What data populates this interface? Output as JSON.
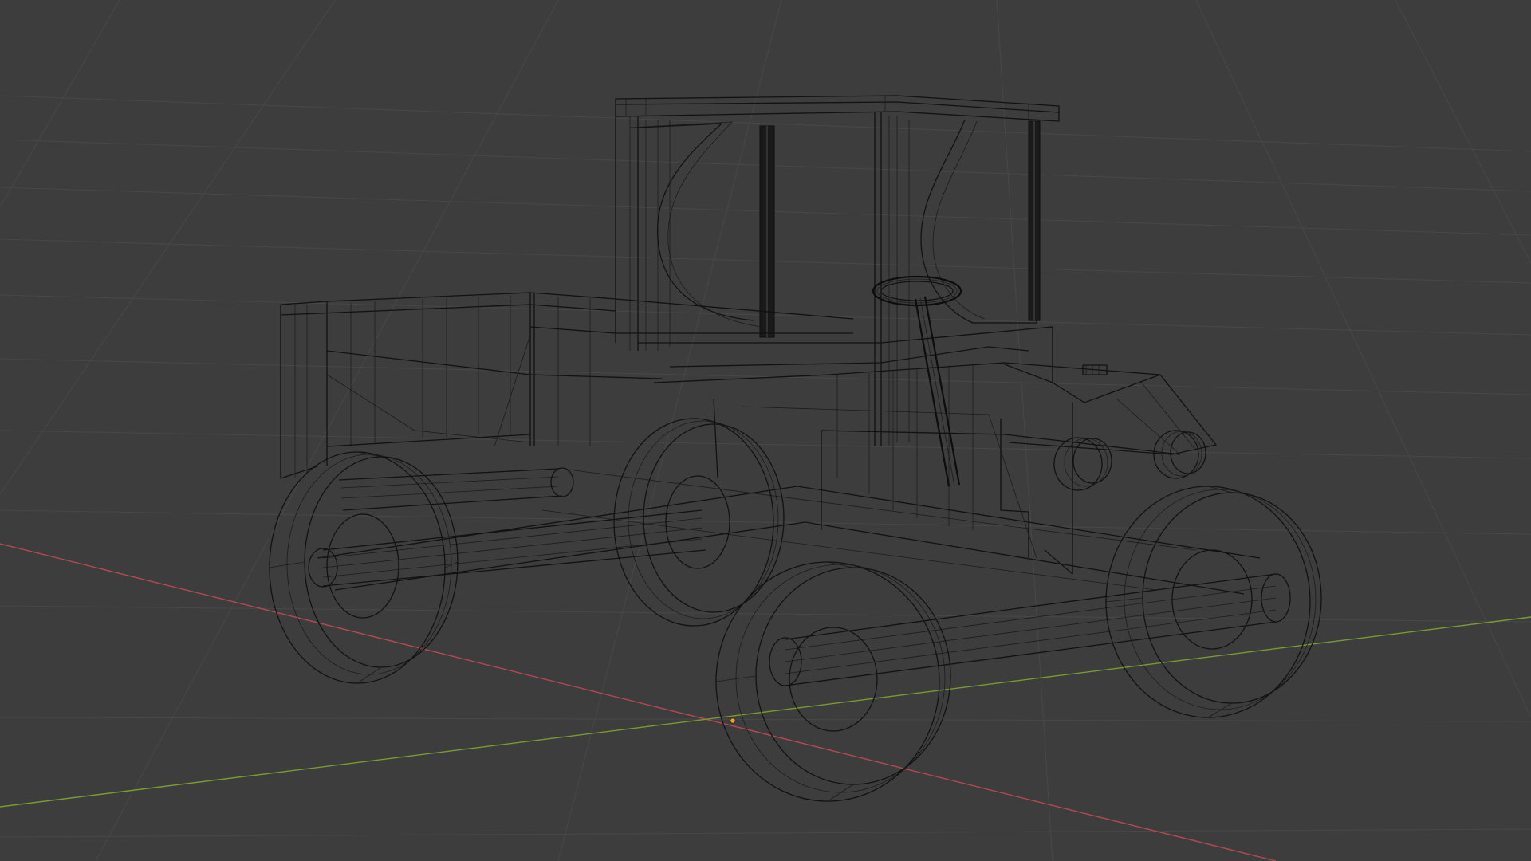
{
  "app": {
    "window": "3D Viewport",
    "shading_mode": "wireframe"
  },
  "viewport": {
    "background": "#3d3d3d",
    "grid_color": "#474747",
    "wire_color": "#121212",
    "x_axis_color": "#b34a52",
    "y_axis_color": "#7a9a32",
    "origin_color": "#f0a030"
  },
  "scene": {
    "object": "truck-wireframe-model",
    "icons": [
      "world-origin-icon"
    ]
  }
}
